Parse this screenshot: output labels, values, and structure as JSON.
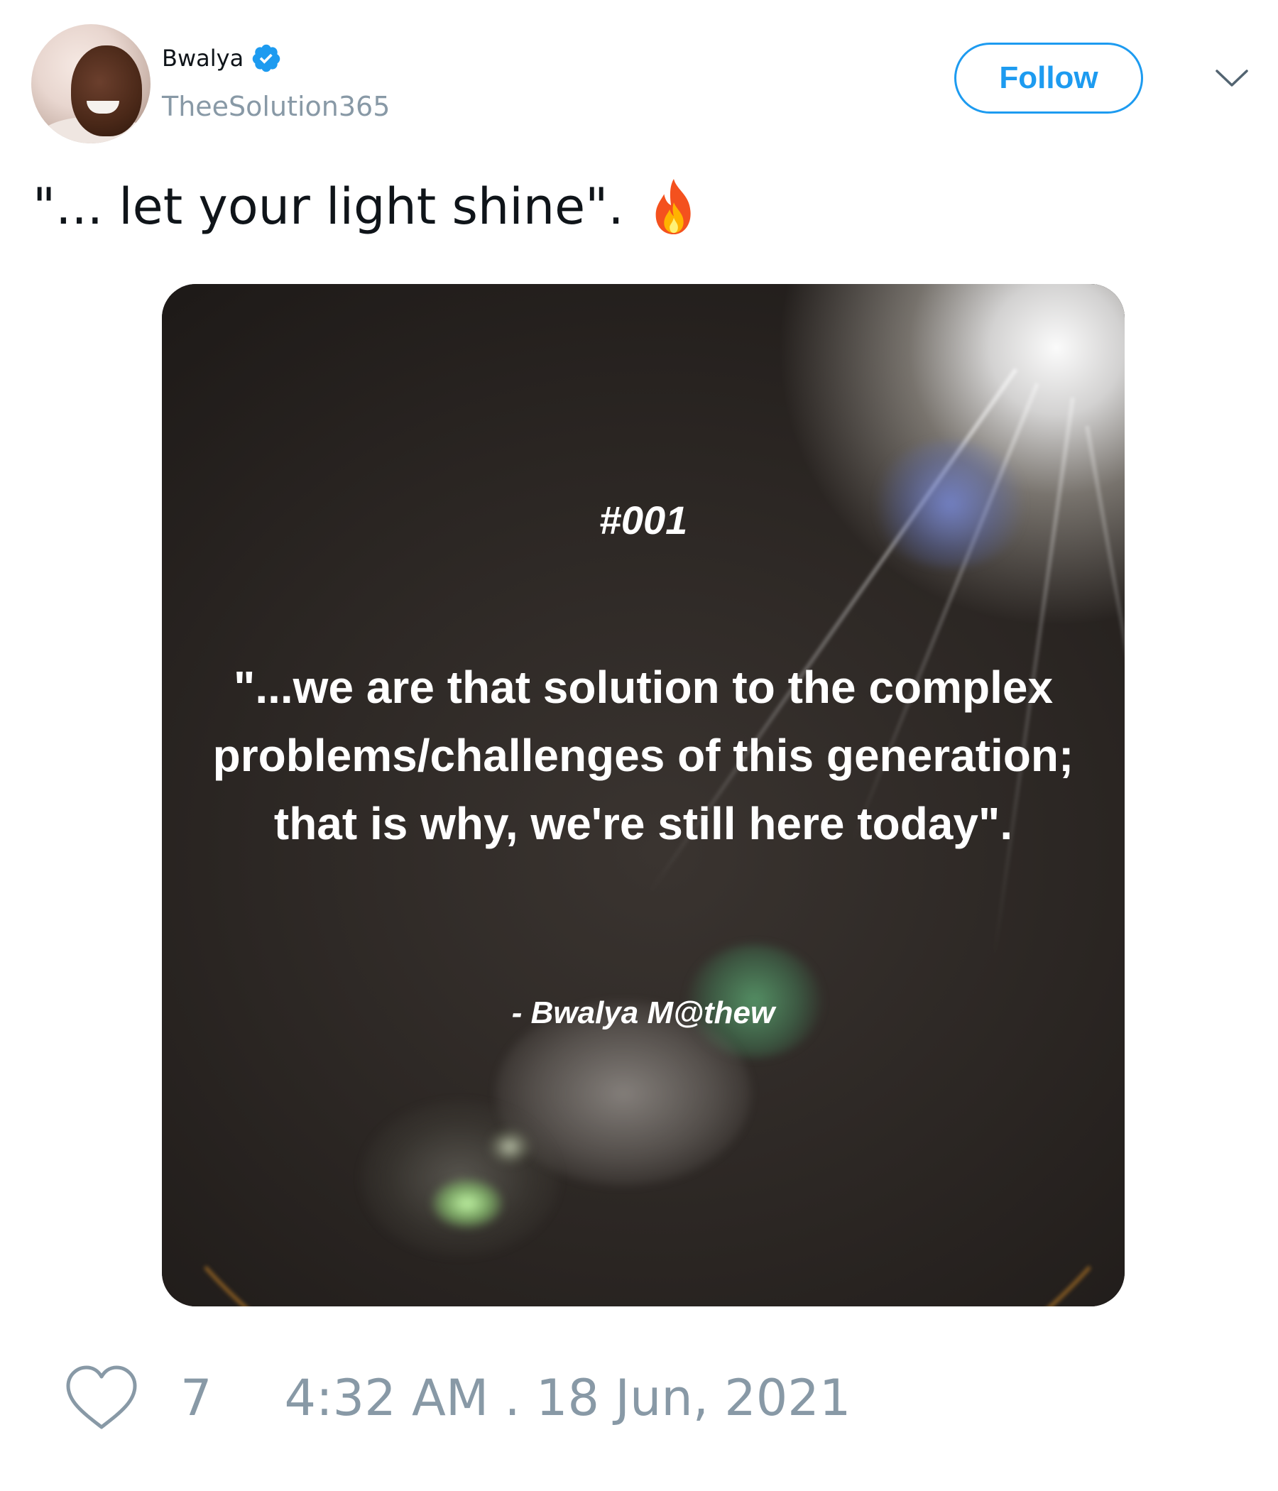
{
  "author": {
    "display_name": "Bwalya",
    "handle": "TheeSolution365",
    "verified": true,
    "avatar_icon": "user-avatar"
  },
  "actions": {
    "follow_label": "Follow",
    "menu_icon": "chevron-down-icon"
  },
  "tweet": {
    "text": "\"... let your light shine\".",
    "emoji_icon": "fire-icon"
  },
  "media": {
    "tag": "#001",
    "quote": "\"...we are that solution to the complex problems/challenges of this generation; that is why, we're still here today\".",
    "attribution": "- Bwalya M@thew"
  },
  "footer": {
    "like_icon": "heart-icon",
    "like_count": "7",
    "timestamp": "4:32 AM . 18 Jun, 2021"
  },
  "colors": {
    "accent": "#1d9bf0",
    "muted": "#8899a6",
    "text": "#0f1419"
  }
}
